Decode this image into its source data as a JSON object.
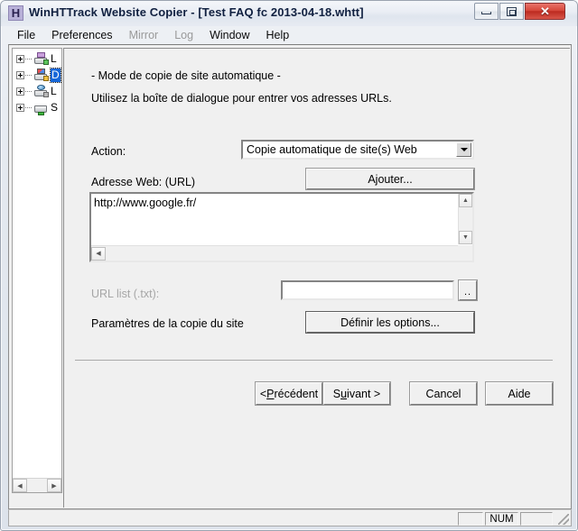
{
  "window": {
    "app_icon": "H",
    "title": "WinHTTrack Website Copier - [Test FAQ fc 2013-04-18.whtt]",
    "controls": {
      "minimize": "minimize-icon",
      "restore": "restore-icon",
      "close": "✕"
    }
  },
  "menubar": {
    "items": [
      {
        "label": "File",
        "disabled": false
      },
      {
        "label": "Preferences",
        "disabled": false
      },
      {
        "label": "Mirror",
        "disabled": true
      },
      {
        "label": "Log",
        "disabled": true
      },
      {
        "label": "Window",
        "disabled": false
      },
      {
        "label": "Help",
        "disabled": false
      }
    ]
  },
  "sidebar": {
    "items": [
      {
        "label": "L",
        "icon": "floppy-printer-icon",
        "selected": false
      },
      {
        "label": "D",
        "icon": "windows-printer-icon",
        "selected": true
      },
      {
        "label": "L",
        "icon": "globe-printer-icon",
        "selected": false
      },
      {
        "label": "S",
        "icon": "server-printer-icon",
        "selected": false
      }
    ],
    "hscroll": {
      "left_arrow": "◀",
      "right_arrow": "▶"
    }
  },
  "content": {
    "heading": "- Mode de copie de site automatique -",
    "instruction": "Utilisez la boîte de dialogue pour entrer vos adresses URLs.",
    "action": {
      "label": "Action:",
      "selected": "Copie automatique de site(s) Web",
      "options": [
        "Copie automatique de site(s) Web"
      ]
    },
    "web_address": {
      "label": "Adresse Web: (URL)",
      "add_button": "Ajouter...",
      "value": "http://www.google.fr/",
      "placeholder": "",
      "vscroll": {
        "up": "▲",
        "down": "▼"
      },
      "hscroll": {
        "left": "◀",
        "right": "▶"
      }
    },
    "url_list": {
      "label": "URL list (.txt):",
      "value": "",
      "placeholder": "",
      "disabled": true,
      "browse_button": ".."
    },
    "params": {
      "label": "Paramètres de la copie du site",
      "options_button": "Définir les options..."
    },
    "wizard_buttons": {
      "previous": "< Précédent",
      "previous_pre": "< ",
      "previous_accel": "P",
      "previous_post": "récédent",
      "next_pre": "S",
      "next_accel": "u",
      "next_post": "ivant >",
      "cancel": "Cancel",
      "help": "Aide"
    }
  },
  "statusbar": {
    "panel1": "",
    "panel2": "NUM",
    "panel3": "",
    "grip": "resize-grip-icon"
  },
  "colors": {
    "face": "#f0f0f0",
    "selection": "#1667d8",
    "close_button": "#bd2a20",
    "disabled_text": "#a6a6a6"
  }
}
